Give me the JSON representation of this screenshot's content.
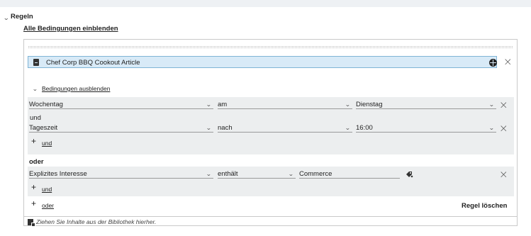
{
  "section": {
    "title": "Regeln",
    "show_all": "Alle Bedingungen einblenden"
  },
  "article": {
    "label": "Chef Corp BBQ Cookout Article"
  },
  "conditions": {
    "hide_label": "Bedingungen ausblenden"
  },
  "group1": {
    "row1": {
      "field": "Wochentag",
      "operator": "am",
      "value": "Dienstag"
    },
    "connector": "und",
    "row2": {
      "field": "Tageszeit",
      "operator": "nach",
      "value": "16:00"
    },
    "add_and": "und"
  },
  "or_label": "oder",
  "group2": {
    "row1": {
      "field": "Explizites Interesse",
      "operator": "enthält",
      "value": "Commerce"
    },
    "add_and": "und"
  },
  "add_or": "oder",
  "delete_rule": "Regel löschen",
  "drop_hint": "Ziehen Sie Inhalte aus der Bibliothek hierher.",
  "icons": {
    "close": "×",
    "add": "+",
    "chevron": "⌄"
  },
  "colors": {
    "article_bg": "#d8eaf7",
    "article_border": "#7fb4d6",
    "group_bg": "#eceeef"
  }
}
